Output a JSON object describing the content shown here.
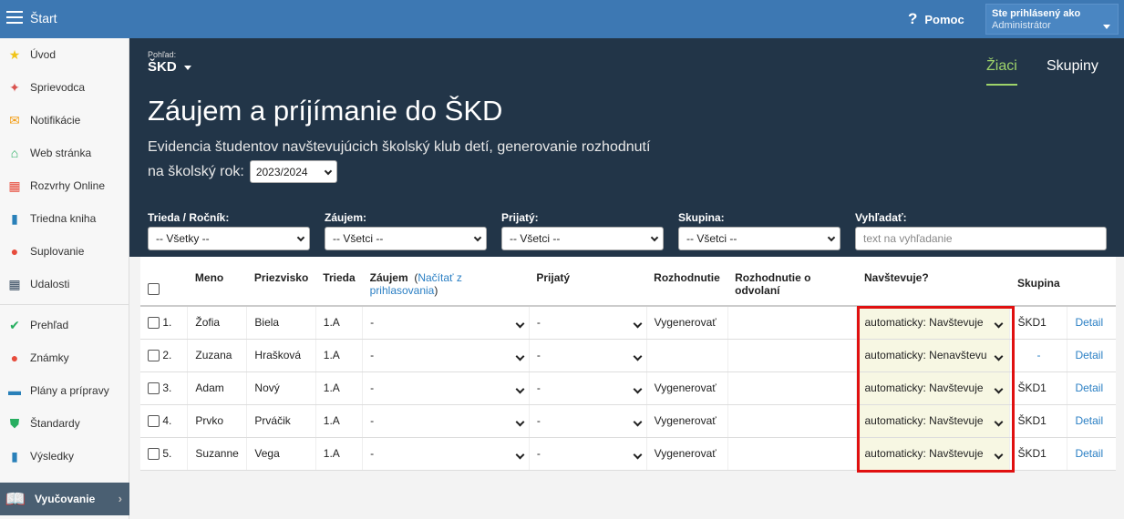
{
  "topbar": {
    "title": "Štart",
    "help": "Pomoc",
    "user_label": "Ste prihlásený ako",
    "user_name": "Administrátor"
  },
  "sidebar": {
    "items": [
      {
        "label": "Úvod",
        "icon": "star-icon",
        "glyph": "★",
        "color": "#f0c419"
      },
      {
        "label": "Sprievodca",
        "icon": "wand-icon",
        "glyph": "✦",
        "color": "#d9534f"
      },
      {
        "label": "Notifikácie",
        "icon": "envelope-icon",
        "glyph": "✉",
        "color": "#f39c12"
      },
      {
        "label": "Web stránka",
        "icon": "home-icon",
        "glyph": "⌂",
        "color": "#27ae60"
      },
      {
        "label": "Rozvrhy Online",
        "icon": "calendar-grid-icon",
        "glyph": "▦",
        "color": "#e74c3c"
      },
      {
        "label": "Triedna kniha",
        "icon": "book-icon",
        "glyph": "▮",
        "color": "#2980b9"
      },
      {
        "label": "Suplovanie",
        "icon": "person-icon",
        "glyph": "●",
        "color": "#e74c3c"
      },
      {
        "label": "Udalosti",
        "icon": "calendar-icon",
        "glyph": "▦",
        "color": "#34495e"
      }
    ],
    "items2": [
      {
        "label": "Prehľad",
        "icon": "check-circle-icon",
        "glyph": "✔",
        "color": "#27ae60"
      },
      {
        "label": "Známky",
        "icon": "grade-icon",
        "glyph": "●",
        "color": "#e74c3c"
      },
      {
        "label": "Plány a prípravy",
        "icon": "briefcase-icon",
        "glyph": "▬",
        "color": "#2980b9"
      },
      {
        "label": "Štandardy",
        "icon": "shield-icon",
        "glyph": "⛊",
        "color": "#27ae60"
      },
      {
        "label": "Výsledky",
        "icon": "bar-chart-icon",
        "glyph": "▮",
        "color": "#2980b9"
      }
    ],
    "bottom": "Vyučovanie"
  },
  "header": {
    "view_label": "Pohľad:",
    "view_value": "ŠKD",
    "tab_students": "Žiaci",
    "tab_groups": "Skupiny",
    "title": "Záujem a príjímanie do ŠKD",
    "subtitle": "Evidencia študentov navštevujúcich školský klub detí, generovanie rozhodnutí",
    "year_prefix": "na školský rok:",
    "year": "2023/2024"
  },
  "filters": {
    "class_label": "Trieda / Ročník:",
    "class_value": "-- Všetky --",
    "interest_label": "Záujem:",
    "interest_value": "-- Všetci --",
    "accepted_label": "Prijatý:",
    "accepted_value": "-- Všetci --",
    "group_label": "Skupina:",
    "group_value": "-- Všetci --",
    "search_label": "Vyhľadať:",
    "search_placeholder": "text na vyhľadanie"
  },
  "table": {
    "headers": {
      "name": "Meno",
      "surname": "Priezvisko",
      "class": "Trieda",
      "interest": "Záujem",
      "load_link": "Načítať z prihlasovania",
      "accepted": "Prijatý",
      "decision": "Rozhodnutie",
      "appeal": "Rozhodnutie o odvolaní",
      "attends": "Navštevuje?",
      "group": "Skupina"
    },
    "rows": [
      {
        "num": "1.",
        "name": "Žofia",
        "surname": "Biela",
        "class": "1.A",
        "interest": "-",
        "accepted": "-",
        "decision": "Vygenerovať",
        "attends": "automaticky: Navštevuje",
        "group": "ŠKD1",
        "detail": "Detail"
      },
      {
        "num": "2.",
        "name": "Zuzana",
        "surname": "Hrašková",
        "class": "1.A",
        "interest": "-",
        "accepted": "-",
        "decision": "",
        "attends": "automaticky: Nenavštevu",
        "group": "-",
        "detail": "Detail"
      },
      {
        "num": "3.",
        "name": "Adam",
        "surname": "Nový",
        "class": "1.A",
        "interest": "-",
        "accepted": "-",
        "decision": "Vygenerovať",
        "attends": "automaticky: Navštevuje",
        "group": "ŠKD1",
        "detail": "Detail"
      },
      {
        "num": "4.",
        "name": "Prvko",
        "surname": "Prváčik",
        "class": "1.A",
        "interest": "-",
        "accepted": "-",
        "decision": "Vygenerovať",
        "attends": "automaticky: Navštevuje",
        "group": "ŠKD1",
        "detail": "Detail"
      },
      {
        "num": "5.",
        "name": "Suzanne",
        "surname": "Vega",
        "class": "1.A",
        "interest": "-",
        "accepted": "-",
        "decision": "Vygenerovať",
        "attends": "automaticky: Navštevuje",
        "group": "ŠKD1",
        "detail": "Detail"
      }
    ]
  }
}
